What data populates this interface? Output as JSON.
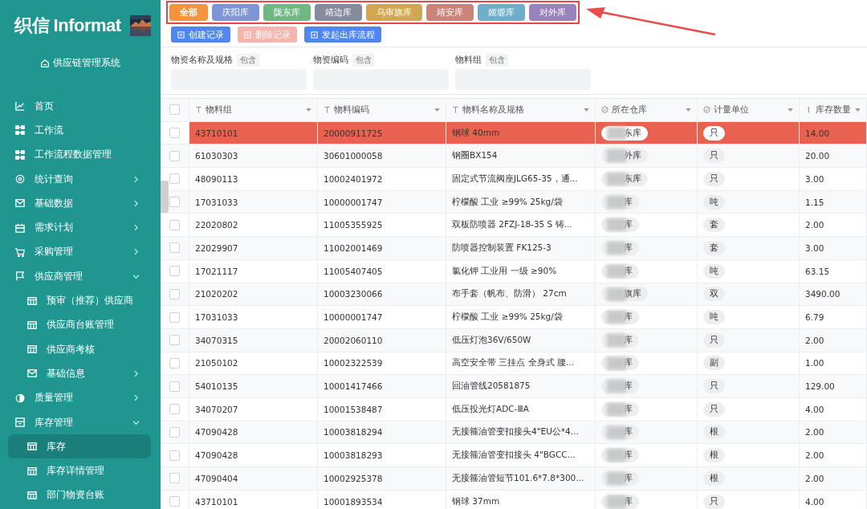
{
  "app": {
    "logo": "织信 Informat",
    "system_title": "供应链管理系统"
  },
  "sidebar": {
    "items": [
      {
        "label": "首页",
        "selected": false
      },
      {
        "label": "工作流",
        "selected": false
      },
      {
        "label": "工作流程数据管理",
        "selected": false
      },
      {
        "label": "统计查询",
        "selected": false,
        "expanded": false
      },
      {
        "label": "基础数据",
        "selected": false,
        "expanded": false
      },
      {
        "label": "需求计划",
        "selected": false,
        "expanded": false
      },
      {
        "label": "采购管理",
        "selected": false,
        "expanded": false
      },
      {
        "label": "供应商管理",
        "selected": false,
        "expanded": true,
        "children": [
          {
            "label": "预审（推荐）供应商",
            "selected": false
          },
          {
            "label": "供应商台账管理",
            "selected": false
          },
          {
            "label": "供应商考核",
            "selected": false
          },
          {
            "label": "基础信息",
            "selected": false,
            "expanded": false
          }
        ]
      },
      {
        "label": "质量管理",
        "selected": false,
        "expanded": false
      },
      {
        "label": "库存管理",
        "selected": false,
        "expanded": true,
        "children": [
          {
            "label": "库存",
            "selected": true
          },
          {
            "label": "库存详情管理",
            "selected": false
          },
          {
            "label": "部门物资台账",
            "selected": false
          }
        ]
      }
    ]
  },
  "tabs": [
    {
      "label": "全部",
      "selected": true,
      "color": "#f5943f"
    },
    {
      "label": "庆阳库",
      "selected": false,
      "color": "#7f95d6"
    },
    {
      "label": "陇东库",
      "selected": false,
      "color": "#6fb884"
    },
    {
      "label": "靖边库",
      "selected": false,
      "color": "#858b9c"
    },
    {
      "label": "乌审旗库",
      "selected": false,
      "color": "#d3a653"
    },
    {
      "label": "靖安库",
      "selected": false,
      "color": "#cc8378"
    },
    {
      "label": "姬塬库",
      "selected": false,
      "color": "#6eaecb"
    },
    {
      "label": "对外库",
      "selected": false,
      "color": "#9a82bd"
    }
  ],
  "buttons": [
    {
      "label": "创建记录",
      "disabled": false
    },
    {
      "label": "删除记录",
      "disabled": true
    },
    {
      "label": "发起出库流程",
      "disabled": false
    }
  ],
  "filters": [
    {
      "label": "物资名称及规格",
      "match": "包含"
    },
    {
      "label": "物资编码",
      "match": "包含"
    },
    {
      "label": "物料组",
      "match": "包含"
    }
  ],
  "table": {
    "all_checked": false,
    "columns": [
      {
        "label": "物料组",
        "kind": "text"
      },
      {
        "label": "物料编码",
        "kind": "text"
      },
      {
        "label": "物料名称及规格",
        "kind": "text"
      },
      {
        "label": "所在仓库",
        "kind": "select"
      },
      {
        "label": "计量单位",
        "kind": "select"
      },
      {
        "label": "库存数量",
        "kind": "number"
      }
    ],
    "rows": [
      {
        "checked": false,
        "highlighted": true,
        "cells": [
          "43710101",
          "20000911725",
          "钢球 40mm",
          "东库",
          "只",
          "14.00"
        ]
      },
      {
        "checked": false,
        "highlighted": false,
        "cells": [
          "61030303",
          "30601000058",
          "钢圈BX154",
          "外库",
          "只",
          "20.00"
        ]
      },
      {
        "checked": false,
        "highlighted": false,
        "cells": [
          "48090113",
          "10002401972",
          "固定式节流阀座JLG65-35，通...",
          "东库",
          "只",
          "3.00"
        ]
      },
      {
        "checked": false,
        "highlighted": false,
        "cells": [
          "17031033",
          "10000001747",
          "柠檬酸 工业 ≥99% 25kg/袋",
          "库",
          "吨",
          "1.15"
        ]
      },
      {
        "checked": false,
        "highlighted": false,
        "cells": [
          "22020802",
          "11005355925",
          "双板防喷器 2FZJ-18-35 S 铸...",
          "库",
          "套",
          "2.00"
        ]
      },
      {
        "checked": false,
        "highlighted": false,
        "cells": [
          "22029907",
          "11002001469",
          "防喷器控制装置 FK125-3",
          "库",
          "套",
          "3.00"
        ]
      },
      {
        "checked": false,
        "highlighted": false,
        "cells": [
          "17021117",
          "11005407405",
          "氯化钾 工业用 一级 ≥90%",
          "库",
          "吨",
          "63.15"
        ]
      },
      {
        "checked": false,
        "highlighted": false,
        "cells": [
          "21020202",
          "10003230066",
          "布手套（帆布、防滑） 27cm",
          "旗库",
          "双",
          "3490.00"
        ]
      },
      {
        "checked": false,
        "highlighted": false,
        "cells": [
          "17031033",
          "10000001747",
          "柠檬酸 工业 ≥99% 25kg/袋",
          "库",
          "吨",
          "6.79"
        ]
      },
      {
        "checked": false,
        "highlighted": false,
        "cells": [
          "34070315",
          "20002060110",
          "低压灯泡36V/650W",
          "库",
          "只",
          "2.00"
        ]
      },
      {
        "checked": false,
        "highlighted": false,
        "cells": [
          "21050102",
          "10002322539",
          "高空安全带 三挂点 全身式 腰...",
          "库",
          "副",
          "1.00"
        ]
      },
      {
        "checked": false,
        "highlighted": false,
        "cells": [
          "54010135",
          "10001417466",
          "回油管线20581875",
          "库",
          "只",
          "129.00"
        ]
      },
      {
        "checked": false,
        "highlighted": false,
        "cells": [
          "34070207",
          "10001538487",
          "低压投光灯ADC-ⅢA",
          "库",
          "只",
          "4.00"
        ]
      },
      {
        "checked": false,
        "highlighted": false,
        "cells": [
          "47090428",
          "10003818294",
          "无接箍油管变扣接头4\"EU公*4...",
          "库",
          "根",
          "2.00"
        ]
      },
      {
        "checked": false,
        "highlighted": false,
        "cells": [
          "47090428",
          "10003818293",
          "无接箍油管变扣接头 4\"BGCC...",
          "库",
          "根",
          "2.00"
        ]
      },
      {
        "checked": false,
        "highlighted": false,
        "cells": [
          "47090404",
          "10002925378",
          "无接箍油管短节101.6*7.8*300...",
          "库",
          "根",
          "2.00"
        ]
      },
      {
        "checked": false,
        "highlighted": false,
        "cells": [
          "43710101",
          "10001893534",
          "钢球 37mm",
          "库",
          "只",
          "4.00"
        ]
      }
    ]
  }
}
